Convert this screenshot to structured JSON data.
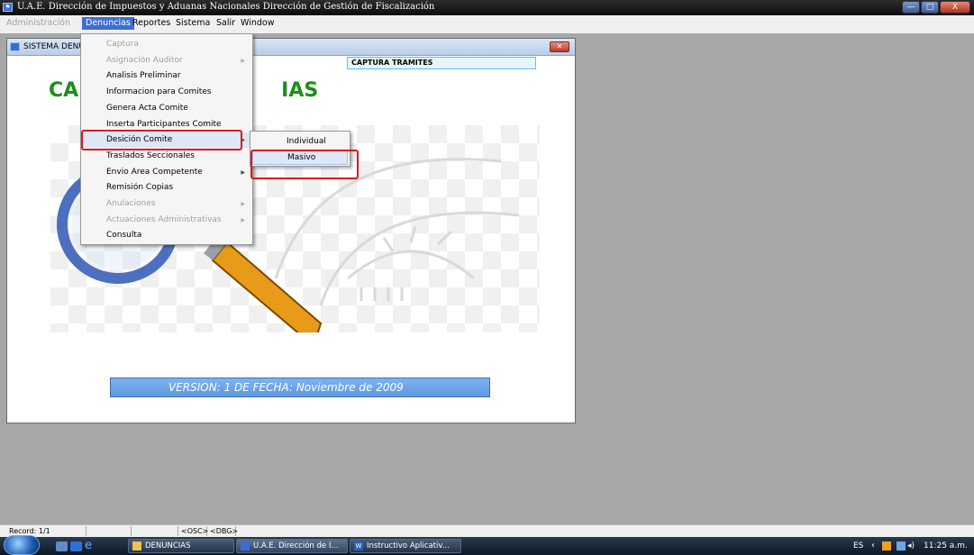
{
  "window": {
    "title": "U.A.E. Dirección de Impuestos y Aduanas Nacionales Dirección de Gestión de Fiscalización",
    "app_icon": "app-icon",
    "minimize_symbol": "—",
    "maximize_symbol": "□",
    "close_symbol": "X"
  },
  "menubar": {
    "items": [
      "Administración",
      "Denuncias",
      "Reportes",
      "Sistema",
      "Salir",
      "Window"
    ],
    "active": "Denuncias"
  },
  "inner_window": {
    "title": "SISTEMA DENU",
    "close_symbol": "✕",
    "captura_label": "CAPTURA TRAMITES",
    "big_title_left": "CA",
    "big_title_right": "IAS",
    "version_text": "VERSION:  1 DE FECHA:  Noviembre de 2009"
  },
  "dropdown": {
    "items": [
      {
        "label": "Captura",
        "enabled": false,
        "submenu": false
      },
      {
        "label": "Asignación Auditor",
        "enabled": false,
        "submenu": true
      },
      {
        "label": "Analisis Preliminar",
        "enabled": true,
        "submenu": false
      },
      {
        "label": "Informacion para Comites",
        "enabled": true,
        "submenu": false
      },
      {
        "label": "Genera Acta Comite",
        "enabled": true,
        "submenu": false
      },
      {
        "label": "Inserta Participantes Comite",
        "enabled": true,
        "submenu": false
      },
      {
        "label": "Desición  Comite",
        "enabled": true,
        "submenu": true,
        "highlighted": true
      },
      {
        "label": "Traslados Seccionales",
        "enabled": true,
        "submenu": false
      },
      {
        "label": "Envio Area Competente",
        "enabled": true,
        "submenu": true
      },
      {
        "label": "Remisión  Copias",
        "enabled": true,
        "submenu": false
      },
      {
        "label": "Anulaciones",
        "enabled": false,
        "submenu": true
      },
      {
        "label": "Actuaciones Administrativas",
        "enabled": false,
        "submenu": true
      },
      {
        "label": "Consulta",
        "enabled": true,
        "submenu": false
      }
    ],
    "arrow_symbol": "▶"
  },
  "submenu": {
    "items": [
      "Individual",
      "Masivo"
    ],
    "highlighted": "Masivo"
  },
  "statusbar": {
    "record": "Record: 1/1",
    "osc": "<OSC>",
    "dbg": "<DBG>"
  },
  "taskbar": {
    "tasks": [
      "DENUNCIAS",
      "U.A.E. Dirección de I...",
      "Instructivo Aplicativ..."
    ],
    "language": "ES",
    "time": "11:25 a.m."
  },
  "colors": {
    "accent_menu": "#3d6fd2",
    "highlight_box": "#e0141e",
    "title_green": "#1a8f1a",
    "version_bg": "#6fa6e8"
  }
}
